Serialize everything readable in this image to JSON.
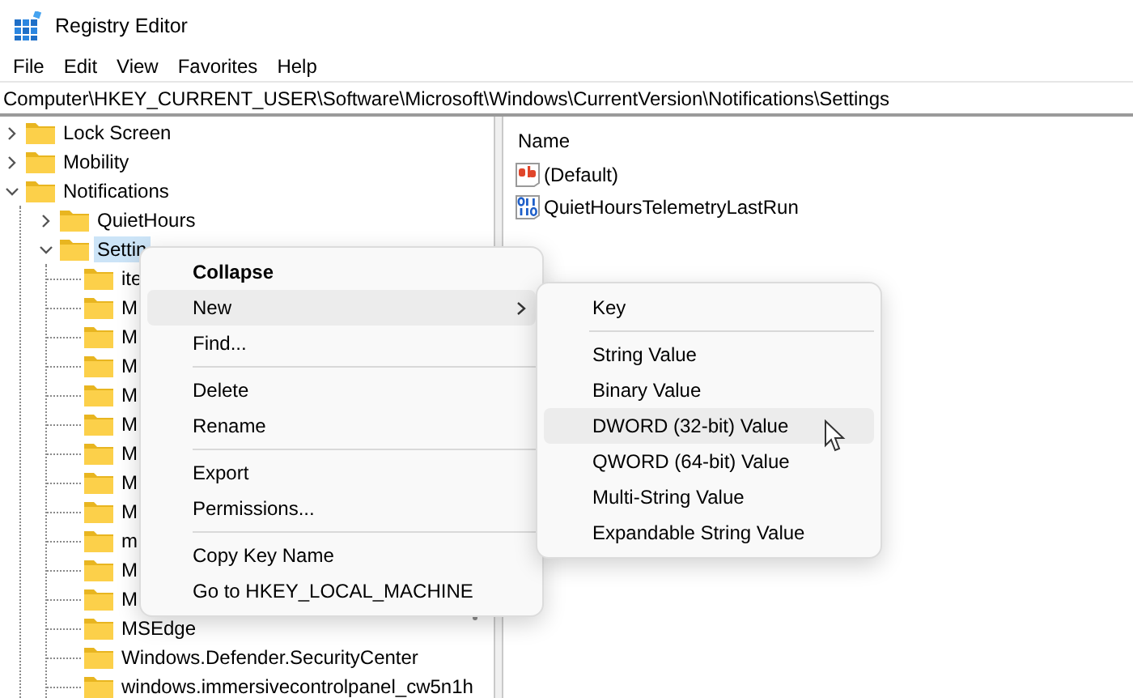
{
  "window": {
    "title": "Registry Editor"
  },
  "menu_bar": [
    "File",
    "Edit",
    "View",
    "Favorites",
    "Help"
  ],
  "address_bar": {
    "value": "Computer\\HKEY_CURRENT_USER\\Software\\Microsoft\\Windows\\CurrentVersion\\Notifications\\Settings"
  },
  "tree": [
    {
      "label": "Lock Screen",
      "expanded": false,
      "selected": false
    },
    {
      "label": "Mobility",
      "expanded": false,
      "selected": false
    },
    {
      "label": "Notifications",
      "expanded": true,
      "selected": false,
      "children": [
        {
          "label": "QuietHours",
          "expanded": false,
          "selected": false
        },
        {
          "label": "Settin",
          "expanded": true,
          "selected": true,
          "children": [
            {
              "label": "ite",
              "selected": false
            },
            {
              "label": "M",
              "selected": false
            },
            {
              "label": "M",
              "selected": false
            },
            {
              "label": "M",
              "selected": false
            },
            {
              "label": "M",
              "selected": false
            },
            {
              "label": "M",
              "selected": false
            },
            {
              "label": "M",
              "selected": false
            },
            {
              "label": "M",
              "selected": false
            },
            {
              "label": "M",
              "selected": false
            },
            {
              "label": "m",
              "selected": false
            },
            {
              "label": "M",
              "selected": false
            },
            {
              "label": "M",
              "selected": false
            },
            {
              "label": "MSEdge",
              "selected": false
            },
            {
              "label": "Windows.Defender.SecurityCenter",
              "selected": false
            },
            {
              "label": "windows.immersivecontrolpanel_cw5n1h",
              "selected": false
            }
          ]
        }
      ]
    }
  ],
  "values_pane": {
    "columns": [
      "Name"
    ],
    "rows": [
      {
        "name": "(Default)",
        "kind": "text"
      },
      {
        "name": "QuietHoursTelemetryLastRun",
        "kind": "number"
      }
    ]
  },
  "context_menu": {
    "items": [
      {
        "kind": "item",
        "label": "Collapse",
        "default": true,
        "selected": false
      },
      {
        "kind": "item",
        "label": "New",
        "submenu": true,
        "selected": true
      },
      {
        "kind": "item",
        "label": "Find...",
        "selected": false
      },
      {
        "kind": "separator"
      },
      {
        "kind": "item",
        "label": "Delete",
        "selected": false
      },
      {
        "kind": "item",
        "label": "Rename",
        "selected": false
      },
      {
        "kind": "separator"
      },
      {
        "kind": "item",
        "label": "Export",
        "selected": false
      },
      {
        "kind": "item",
        "label": "Permissions...",
        "selected": false
      },
      {
        "kind": "separator"
      },
      {
        "kind": "item",
        "label": "Copy Key Name",
        "selected": false
      },
      {
        "kind": "item",
        "label": "Go to HKEY_LOCAL_MACHINE",
        "selected": false
      }
    ]
  },
  "submenu": {
    "items": [
      {
        "kind": "item",
        "label": "Key",
        "selected": false
      },
      {
        "kind": "separator"
      },
      {
        "kind": "item",
        "label": "String Value",
        "selected": false
      },
      {
        "kind": "item",
        "label": "Binary Value",
        "selected": false
      },
      {
        "kind": "item",
        "label": "DWORD (32-bit) Value",
        "selected": true
      },
      {
        "kind": "item",
        "label": "QWORD (64-bit) Value",
        "selected": false
      },
      {
        "kind": "item",
        "label": "Multi-String Value",
        "selected": false
      },
      {
        "kind": "item",
        "label": "Expandable String Value",
        "selected": false
      }
    ]
  }
}
